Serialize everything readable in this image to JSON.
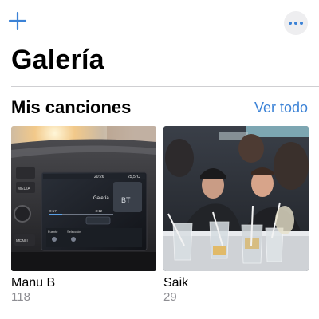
{
  "header": {
    "add_icon": "plus-icon",
    "more_icon": "ellipsis-icon",
    "title": "Galería"
  },
  "section": {
    "title": "Mis canciones",
    "see_all": "Ver todo"
  },
  "cards": [
    {
      "title": "Manu B",
      "count": "118",
      "screen_title": "Galería",
      "screen_bt": "BT",
      "screen_time_left": "0:17",
      "screen_time_right": "-3:12",
      "screen_clock": "20:26",
      "screen_temp": "25,5°C",
      "screen_src1": "Fuente",
      "screen_src2": "Selección",
      "screen_menu": "MENU",
      "screen_media": "MEDIA"
    },
    {
      "title": "Saik",
      "count": "29"
    }
  ],
  "colors": {
    "accent": "#3b82d6",
    "divider": "#cfcfd2",
    "secondary_text": "#8e8e93"
  }
}
